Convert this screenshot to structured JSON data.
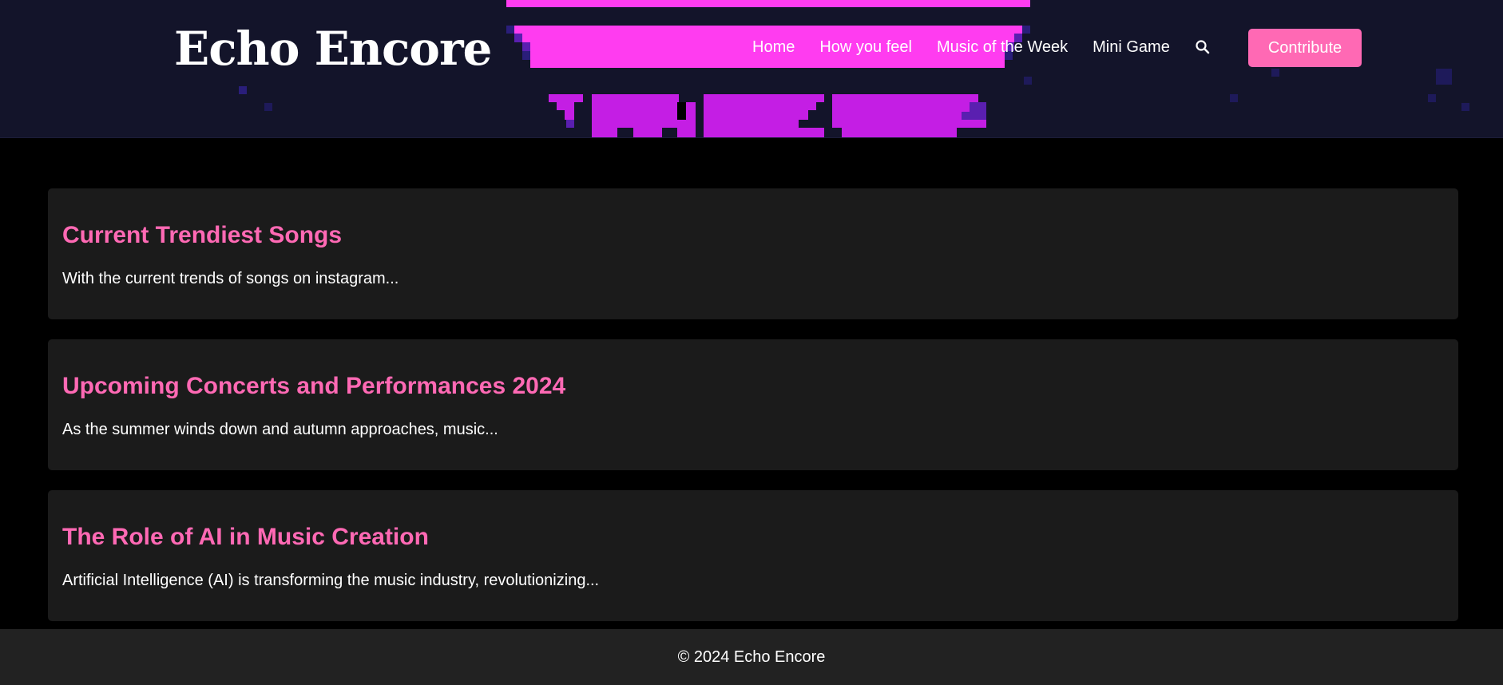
{
  "site": {
    "title": "Echo Encore"
  },
  "nav": {
    "items": [
      {
        "label": "Home"
      },
      {
        "label": "How you feel"
      },
      {
        "label": "Music of the Week"
      },
      {
        "label": "Mini Game"
      }
    ],
    "search_icon": "search-icon",
    "contribute_label": "Contribute"
  },
  "posts": [
    {
      "title": "Current Trendiest Songs",
      "excerpt": "With the current trends of songs on instagram..."
    },
    {
      "title": "Upcoming Concerts and Performances 2024",
      "excerpt": "As the summer winds down and autumn approaches, music..."
    },
    {
      "title": "The Role of AI in Music Creation",
      "excerpt": "Artificial Intelligence (AI) is transforming the music industry, revolutionizing..."
    }
  ],
  "footer": {
    "text": "© 2024 Echo Encore"
  },
  "colors": {
    "header_bg": "#13142a",
    "page_bg": "#000000",
    "card_bg": "#1b1b1b",
    "accent": "#ff69b4",
    "footer_bg": "#222222",
    "pixel_magenta": "#ff3cf0",
    "pixel_purple": "#c41ee4"
  }
}
